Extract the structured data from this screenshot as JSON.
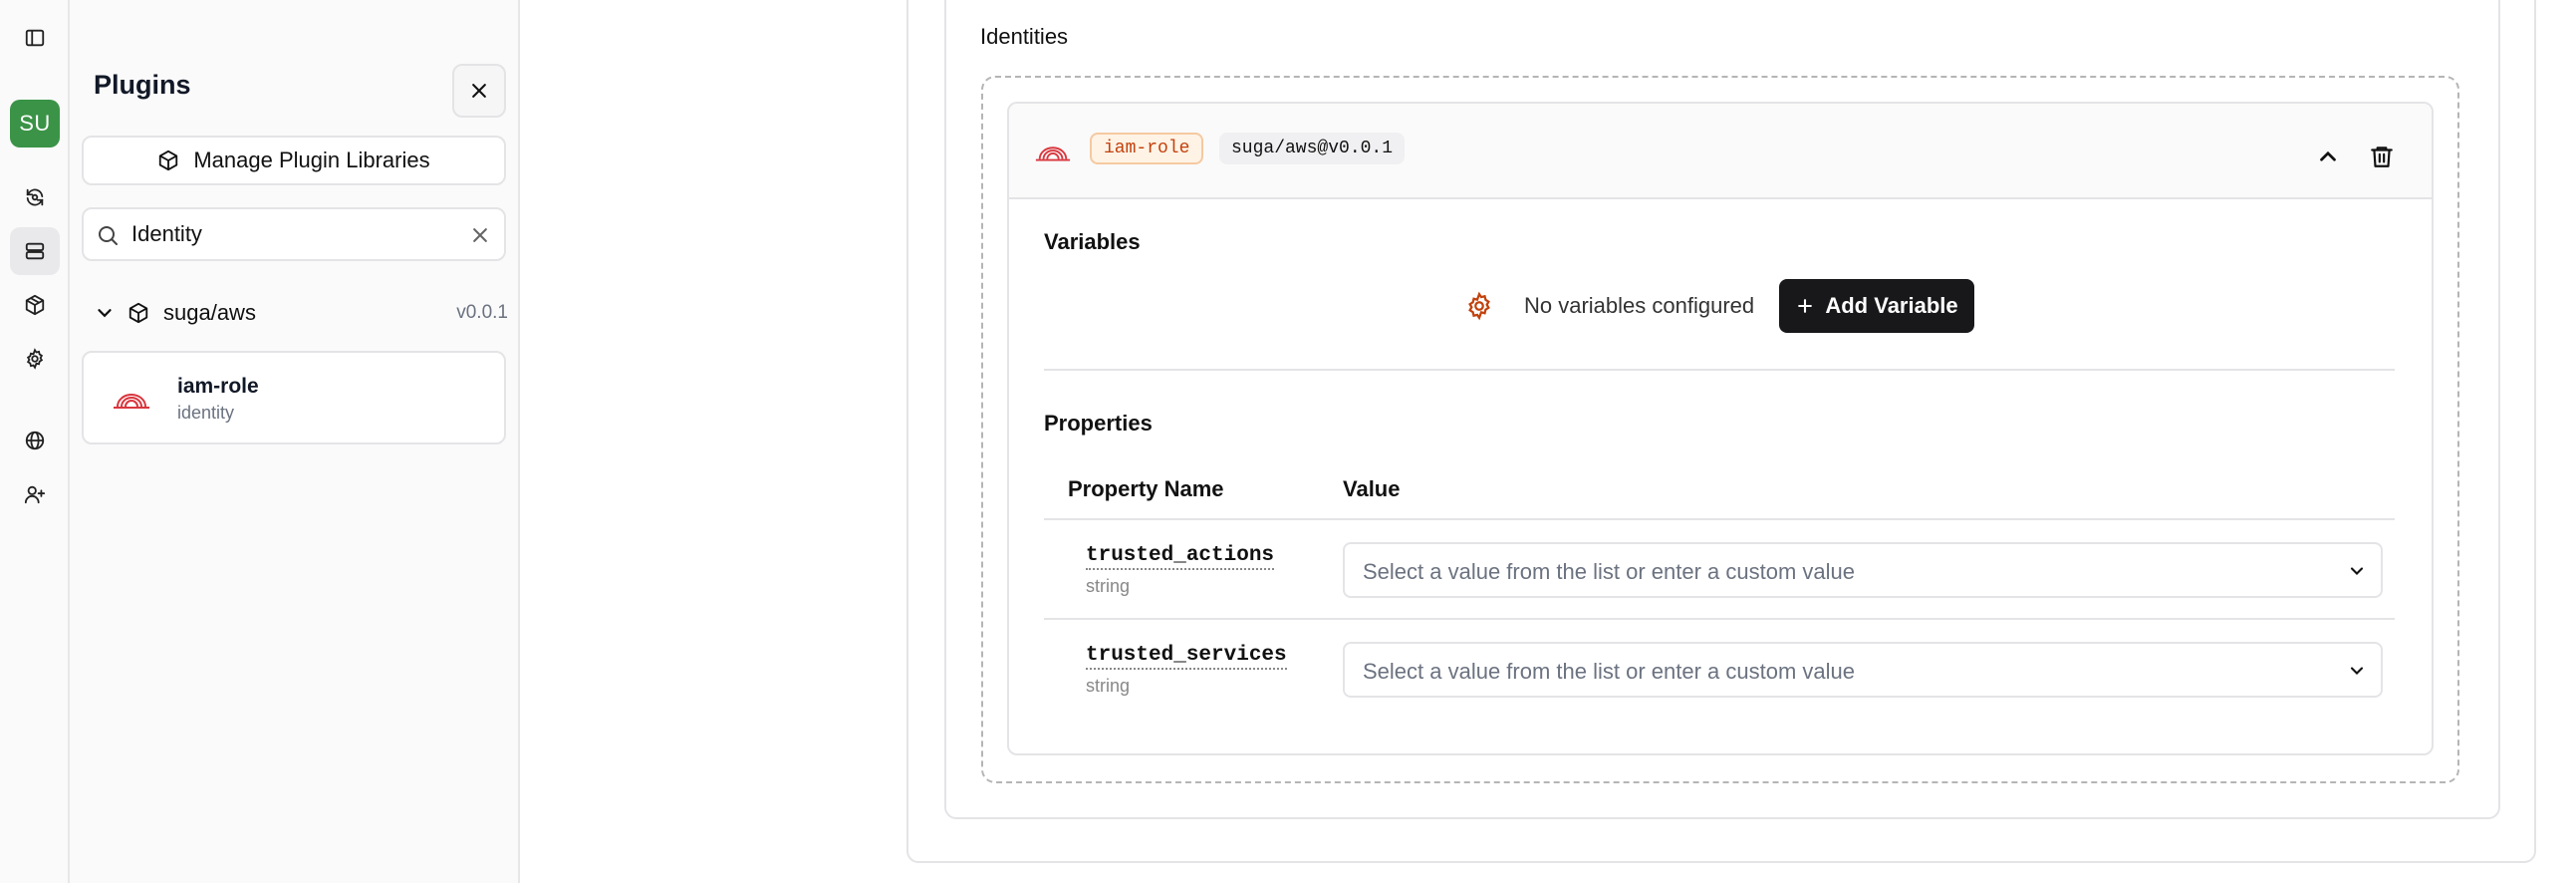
{
  "rail": {
    "avatar_initials": "SU",
    "items": [
      {
        "icon": "sidebar-toggle-icon"
      },
      {
        "icon": "refresh-icon"
      },
      {
        "icon": "server-icon",
        "active": true
      },
      {
        "icon": "package-icon"
      },
      {
        "icon": "gear-icon"
      },
      {
        "icon": "globe-icon"
      },
      {
        "icon": "user-plus-icon"
      }
    ]
  },
  "plugins_panel": {
    "title": "Plugins",
    "manage_button_label": "Manage Plugin Libraries",
    "search_value": "Identity",
    "groups": [
      {
        "name": "suga/aws",
        "version": "v0.0.1",
        "expanded": true,
        "items": [
          {
            "name": "iam-role",
            "type": "identity"
          }
        ]
      }
    ]
  },
  "main": {
    "section_title": "Identities",
    "resource": {
      "type_badge": "iam-role",
      "package_badge": "suga/aws@v0.0.1",
      "variables": {
        "title": "Variables",
        "empty_text": "No variables configured",
        "add_button_label": "Add Variable"
      },
      "properties": {
        "title": "Properties",
        "columns": [
          "Property Name",
          "Value"
        ],
        "rows": [
          {
            "name": "trusted_actions",
            "type": "string",
            "placeholder": "Select a value from the list or enter a custom value"
          },
          {
            "name": "trusted_services",
            "type": "string",
            "placeholder": "Select a value from the list or enter a custom value"
          }
        ]
      }
    }
  },
  "colors": {
    "avatar_bg": "#3a9346",
    "accent_dark": "#18181b",
    "badge_orange": "#c2410c",
    "aws_red": "#d9363e"
  }
}
